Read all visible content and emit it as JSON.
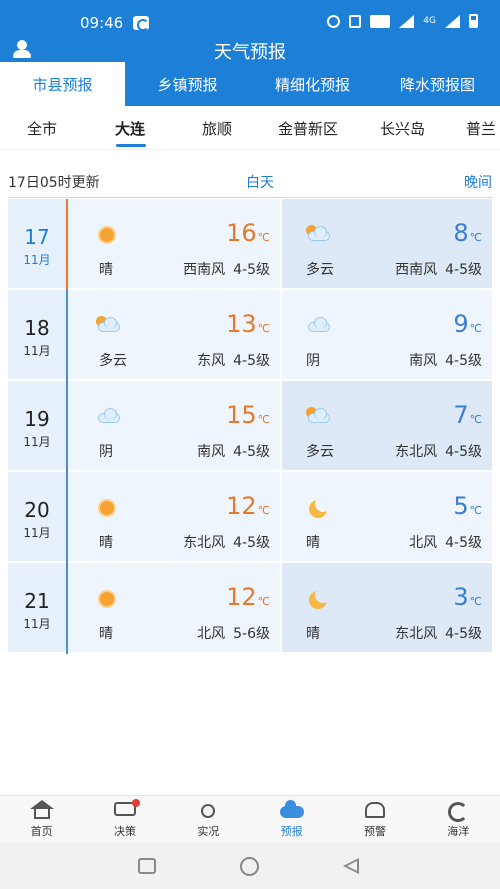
{
  "status_bar": {
    "time": "09:46",
    "network": "4G"
  },
  "header": {
    "title": "天气预报"
  },
  "main_tabs": [
    {
      "label": "市县预报",
      "active": true
    },
    {
      "label": "乡镇预报",
      "active": false
    },
    {
      "label": "精细化预报",
      "active": false
    },
    {
      "label": "降水预报图",
      "active": false
    }
  ],
  "city_tabs": [
    {
      "label": "全市",
      "active": false
    },
    {
      "label": "大连",
      "active": true
    },
    {
      "label": "旅顺",
      "active": false
    },
    {
      "label": "金普新区",
      "active": false
    },
    {
      "label": "长兴岛",
      "active": false
    },
    {
      "label": "普兰",
      "active": false
    }
  ],
  "update": {
    "text": "17日05时更新",
    "day_label": "白天",
    "night_label": "晚间"
  },
  "temp_unit": "℃",
  "forecast": [
    {
      "day": "17",
      "month": "11月",
      "day_weather": {
        "icon": "sunny-icon",
        "condition": "晴",
        "temp": "16",
        "wind_dir": "西南风",
        "wind_level": "4-5级"
      },
      "night_weather": {
        "icon": "partly-cloudy-icon",
        "condition": "多云",
        "temp": "8",
        "wind_dir": "西南风",
        "wind_level": "4-5级"
      }
    },
    {
      "day": "18",
      "month": "11月",
      "day_weather": {
        "icon": "partly-cloudy-icon",
        "condition": "多云",
        "temp": "13",
        "wind_dir": "东风",
        "wind_level": "4-5级"
      },
      "night_weather": {
        "icon": "cloudy-icon",
        "condition": "阴",
        "temp": "9",
        "wind_dir": "南风",
        "wind_level": "4-5级"
      }
    },
    {
      "day": "19",
      "month": "11月",
      "day_weather": {
        "icon": "cloudy-icon",
        "condition": "阴",
        "temp": "15",
        "wind_dir": "南风",
        "wind_level": "4-5级"
      },
      "night_weather": {
        "icon": "partly-cloudy-icon",
        "condition": "多云",
        "temp": "7",
        "wind_dir": "东北风",
        "wind_level": "4-5级"
      }
    },
    {
      "day": "20",
      "month": "11月",
      "day_weather": {
        "icon": "sunny-icon",
        "condition": "晴",
        "temp": "12",
        "wind_dir": "东北风",
        "wind_level": "4-5级"
      },
      "night_weather": {
        "icon": "moon-icon",
        "condition": "晴",
        "temp": "5",
        "wind_dir": "北风",
        "wind_level": "4-5级"
      }
    },
    {
      "day": "21",
      "month": "11月",
      "day_weather": {
        "icon": "sunny-icon",
        "condition": "晴",
        "temp": "12",
        "wind_dir": "北风",
        "wind_level": "5-6级"
      },
      "night_weather": {
        "icon": "moon-icon",
        "condition": "晴",
        "temp": "3",
        "wind_dir": "东北风",
        "wind_level": "4-5级"
      }
    }
  ],
  "bottom_nav": [
    {
      "label": "首页",
      "icon": "home-icon",
      "active": false
    },
    {
      "label": "决策",
      "icon": "chat-icon",
      "active": false,
      "badge": true
    },
    {
      "label": "实况",
      "icon": "sun-icon",
      "active": false
    },
    {
      "label": "预报",
      "icon": "forecast-icon",
      "active": true
    },
    {
      "label": "预警",
      "icon": "warning-icon",
      "active": false
    },
    {
      "label": "海洋",
      "icon": "ocean-icon",
      "active": false
    }
  ],
  "colors": {
    "primary": "#1e7fd6",
    "day_temp": "#e57a2c",
    "night_temp": "#3a7fd2"
  }
}
